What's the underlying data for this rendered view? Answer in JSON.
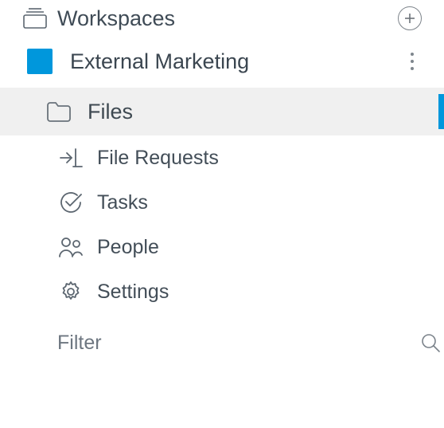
{
  "sidebar": {
    "header": {
      "title": "Workspaces"
    },
    "workspace": {
      "name": "External Marketing",
      "color": "#0097dc"
    },
    "nav": [
      {
        "id": "files",
        "label": "Files",
        "active": true
      },
      {
        "id": "file-requests",
        "label": "File Requests",
        "active": false
      },
      {
        "id": "tasks",
        "label": "Tasks",
        "active": false
      },
      {
        "id": "people",
        "label": "People",
        "active": false
      },
      {
        "id": "settings",
        "label": "Settings",
        "active": false
      }
    ],
    "filter": {
      "label": "Filter"
    }
  }
}
